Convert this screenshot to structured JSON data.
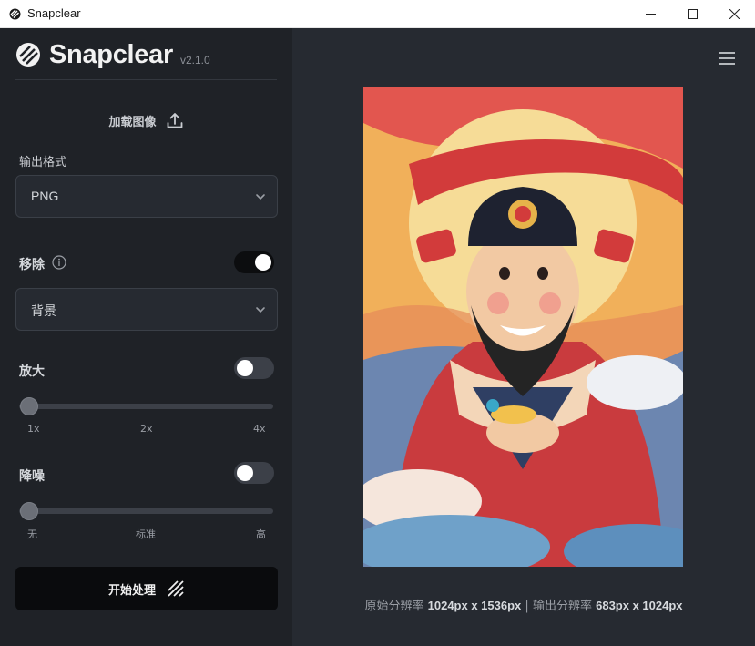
{
  "window": {
    "title": "Snapclear"
  },
  "sidebar": {
    "logo_text": "Snapclear",
    "version": "v2.1.0",
    "load_image_label": "加载图像",
    "output_format": {
      "label": "输出格式",
      "value": "PNG"
    },
    "remove": {
      "label": "移除",
      "enabled": true,
      "target": "背景"
    },
    "upscale": {
      "label": "放大",
      "enabled": false,
      "value": "1x",
      "ticks": [
        "1x",
        "2x",
        "4x"
      ]
    },
    "denoise": {
      "label": "降噪",
      "enabled": false,
      "value": "无",
      "ticks": [
        "无",
        "标准",
        "高"
      ]
    },
    "start_label": "开始处理"
  },
  "main": {
    "resolution": {
      "original_label": "原始分辨率",
      "original_value": "1024px x 1536px",
      "separator": "|",
      "output_label": "输出分辨率",
      "output_value": "683px x 1024px"
    }
  },
  "colors": {
    "sidebar_bg": "#1f2227",
    "main_bg": "#262a31",
    "start_button_bg": "#0a0b0d",
    "toggle_on": "#0c0d0f",
    "toggle_off": "#3c4048"
  },
  "icons": {
    "app": "slash-circle-icon",
    "load": "upload-icon",
    "info": "info-circle-icon",
    "chevron": "chevron-down-icon",
    "start": "diagonal-stripes-icon",
    "menu": "hamburger-menu-icon"
  }
}
